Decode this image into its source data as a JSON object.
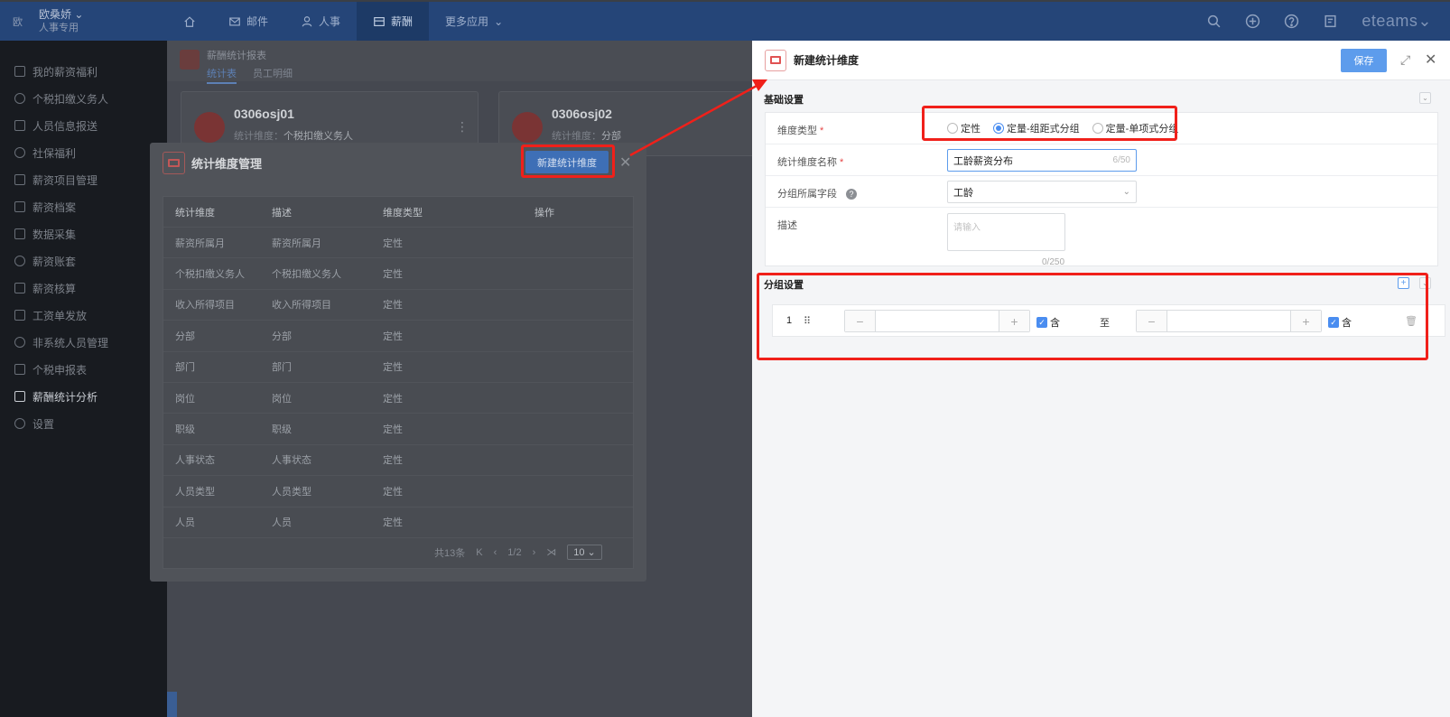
{
  "topbar": {
    "logo_char": "欧",
    "user_name": "欧桑娇",
    "user_role": "人事专用",
    "nav": [
      {
        "label": ""
      },
      {
        "label": "邮件"
      },
      {
        "label": "人事"
      },
      {
        "label": "薪酬"
      },
      {
        "label": "更多应用"
      }
    ],
    "brand": "eteams"
  },
  "sidebar": {
    "items": [
      {
        "label": "我的薪资福利"
      },
      {
        "label": "个税扣缴义务人"
      },
      {
        "label": "人员信息报送"
      },
      {
        "label": "社保福利"
      },
      {
        "label": "薪资项目管理"
      },
      {
        "label": "薪资档案"
      },
      {
        "label": "数据采集"
      },
      {
        "label": "薪资账套"
      },
      {
        "label": "薪资核算"
      },
      {
        "label": "工资单发放"
      },
      {
        "label": "非系统人员管理"
      },
      {
        "label": "个税申报表"
      },
      {
        "label": "薪酬统计分析"
      },
      {
        "label": "设置"
      }
    ]
  },
  "background": {
    "report_title": "薪酬统计报表",
    "tabs": [
      "统计表",
      "员工明细"
    ],
    "cards": [
      {
        "name": "0306osj01",
        "sub_label": "统计维度：",
        "sub_value": "个税扣缴义务人"
      },
      {
        "name": "0306osj02",
        "sub_label": "统计维度：",
        "sub_value": "分部"
      }
    ]
  },
  "modal": {
    "title": "统计维度管理",
    "new_button": "新建统计维度",
    "columns": [
      "统计维度",
      "描述",
      "维度类型",
      "操作"
    ],
    "rows": [
      [
        "薪资所属月",
        "薪资所属月",
        "定性"
      ],
      [
        "个税扣缴义务人",
        "个税扣缴义务人",
        "定性"
      ],
      [
        "收入所得项目",
        "收入所得项目",
        "定性"
      ],
      [
        "分部",
        "分部",
        "定性"
      ],
      [
        "部门",
        "部门",
        "定性"
      ],
      [
        "岗位",
        "岗位",
        "定性"
      ],
      [
        "职级",
        "职级",
        "定性"
      ],
      [
        "人事状态",
        "人事状态",
        "定性"
      ],
      [
        "人员类型",
        "人员类型",
        "定性"
      ],
      [
        "人员",
        "人员",
        "定性"
      ]
    ],
    "pager": {
      "total": "共13条",
      "page": "1/2",
      "size": "10"
    }
  },
  "drawer": {
    "title": "新建统计维度",
    "save_label": "保存",
    "basic_section": "基础设置",
    "type_label": "维度类型",
    "type_options": [
      "定性",
      "定量-组距式分组",
      "定量-单项式分组"
    ],
    "type_selected": "定量-组距式分组",
    "name_label": "统计维度名称",
    "name_value": "工龄薪资分布",
    "name_count": "6/50",
    "field_label": "分组所属字段",
    "field_value": "工龄",
    "desc_label": "描述",
    "desc_placeholder": "请输入",
    "desc_count": "0/250",
    "group_section": "分组设置",
    "group_row": {
      "index": "1",
      "include_label": "含",
      "to_label": "至"
    }
  },
  "colors": {
    "highlight": "#f0201a",
    "primary": "#5d9cec",
    "topbar": "#254578"
  }
}
